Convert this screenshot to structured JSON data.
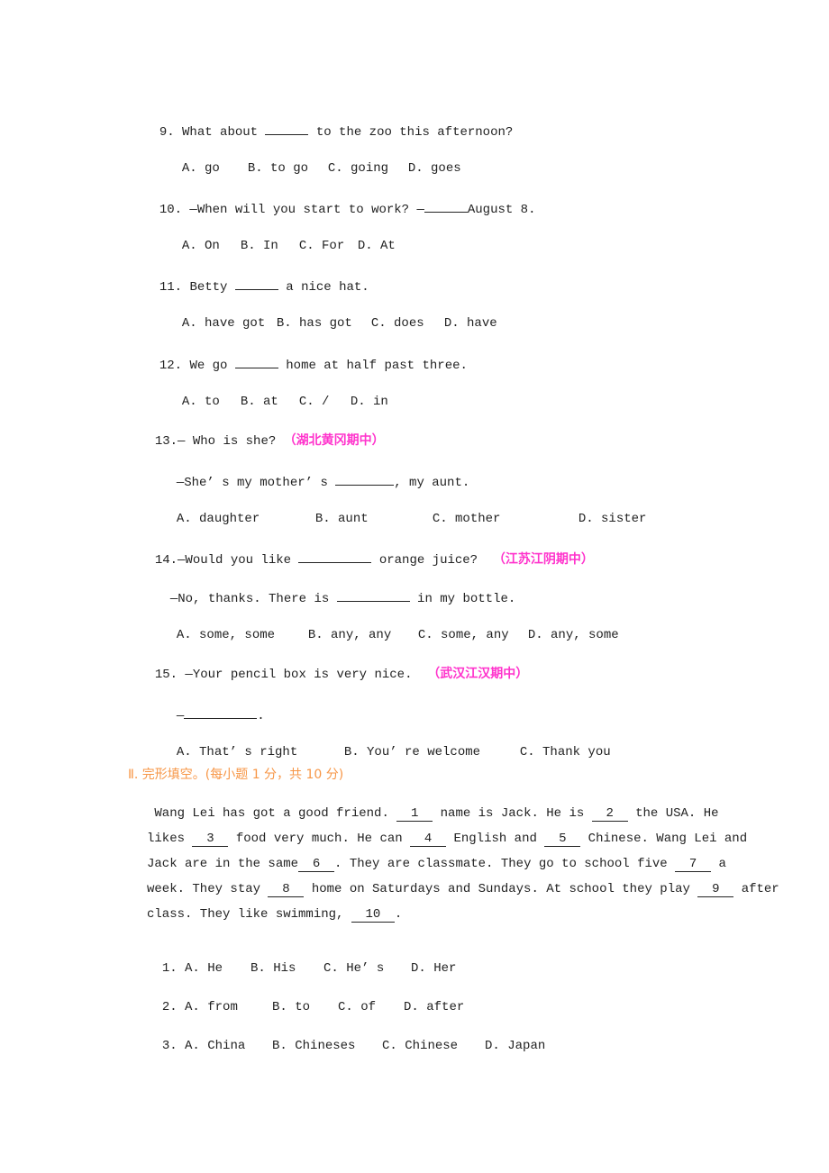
{
  "questions": [
    {
      "num": "9.",
      "stem_pre": "What about ",
      "stem_post": " to the zoo this afternoon?",
      "options": [
        "A. go",
        "B. to go",
        "C. going",
        "D. goes"
      ]
    },
    {
      "num": "10.",
      "stem_pre": " —When will you start to work? —",
      "stem_post": "August 8.",
      "options": [
        "A. On",
        "B. In",
        "C. For",
        "D. At"
      ]
    },
    {
      "num": "11.",
      "stem_pre": "Betty ",
      "stem_post": " a nice hat.",
      "options": [
        "A. have got",
        "B. has got",
        "C. does",
        "D. have"
      ]
    },
    {
      "num": "12.",
      "stem_pre": "We go ",
      "stem_post": " home at half past three.",
      "options": [
        "A. to",
        "B. at",
        "C. /",
        "D. in"
      ]
    },
    {
      "num": "13.",
      "stem_pre": "— Who is she? ",
      "source": "（湖北黄冈期中）",
      "reply_pre": "—She’ s my mother’ s ",
      "reply_post": ", my aunt.",
      "options": [
        "A. daughter",
        "B. aunt",
        "C. mother",
        "D. sister"
      ]
    },
    {
      "num": "14.",
      "stem_pre": "—Would you like ",
      "stem_post": " orange juice?  ",
      "source": "（江苏江阴期中）",
      "reply_pre": "—No, thanks. There is ",
      "reply_post": " in my bottle.",
      "options": [
        "A. some, some",
        "B. any, any",
        "C. some, any",
        "D. any, some"
      ]
    },
    {
      "num": "15.",
      "stem_pre": " —Your pencil box is very nice.  ",
      "source": "（武汉江汉期中）",
      "reply_pre": "—",
      "reply_post": ".",
      "options": [
        "A. That’ s right",
        "B. You’ re welcome",
        "C. Thank you"
      ]
    }
  ],
  "section2": {
    "title": "Ⅱ. 完形填空。(每小题 1 分，共 10 分)",
    "passage": [
      [
        " Wang Lei has got a good friend. ",
        {
          "b": "1"
        },
        " name is Jack. He is ",
        {
          "b": "2"
        },
        " the USA. He"
      ],
      [
        "likes ",
        {
          "b": "3"
        },
        " food very much. He can ",
        {
          "b": "4"
        },
        " English and ",
        {
          "b": "5"
        },
        " Chinese. Wang Lei and"
      ],
      [
        "Jack are in the same",
        {
          "b": "6"
        },
        ". They are classmate. They go to school five ",
        {
          "b": "7"
        },
        " a"
      ],
      [
        "week. They stay ",
        {
          "b": "8"
        },
        " home on Saturdays and Sundays. At school they play ",
        {
          "b": "9"
        },
        " after"
      ],
      [
        "class. They like swimming, ",
        {
          "b": "10"
        },
        "."
      ]
    ],
    "items": [
      {
        "num": "1.",
        "options": [
          "A. He",
          "B. His",
          "C. He’ s",
          "D. Her"
        ]
      },
      {
        "num": "2.",
        "options": [
          "A. from",
          "B. to",
          "C. of",
          "D. after"
        ]
      },
      {
        "num": "3.",
        "options": [
          "A. China",
          "B. Chineses",
          "C. Chinese",
          "D. Japan"
        ]
      }
    ]
  },
  "colors": {
    "source_tag": "#ff33cc",
    "section_title": "#f79646"
  }
}
